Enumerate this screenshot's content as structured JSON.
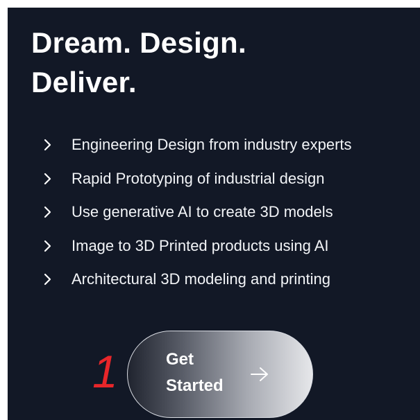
{
  "hero": {
    "headline_line1": "Dream. Design.",
    "headline_line2": "Deliver."
  },
  "features": [
    {
      "label": "Engineering Design from industry experts",
      "icon": "chevron-right-icon"
    },
    {
      "label": "Rapid Prototyping of industrial design",
      "icon": "chevron-right-icon"
    },
    {
      "label": "Use generative AI to create 3D models",
      "icon": "chevron-right-icon"
    },
    {
      "label": "Image to 3D Printed products using AI",
      "icon": "chevron-right-icon"
    },
    {
      "label": "Architectural 3D modeling and printing",
      "icon": "chevron-right-icon"
    }
  ],
  "cta": {
    "label": "Get\nStarted",
    "icon": "arrow-right-icon"
  },
  "annotation": {
    "marker": "1",
    "color": "#e8262a"
  },
  "colors": {
    "background": "#121826",
    "text": "#ffffff"
  }
}
